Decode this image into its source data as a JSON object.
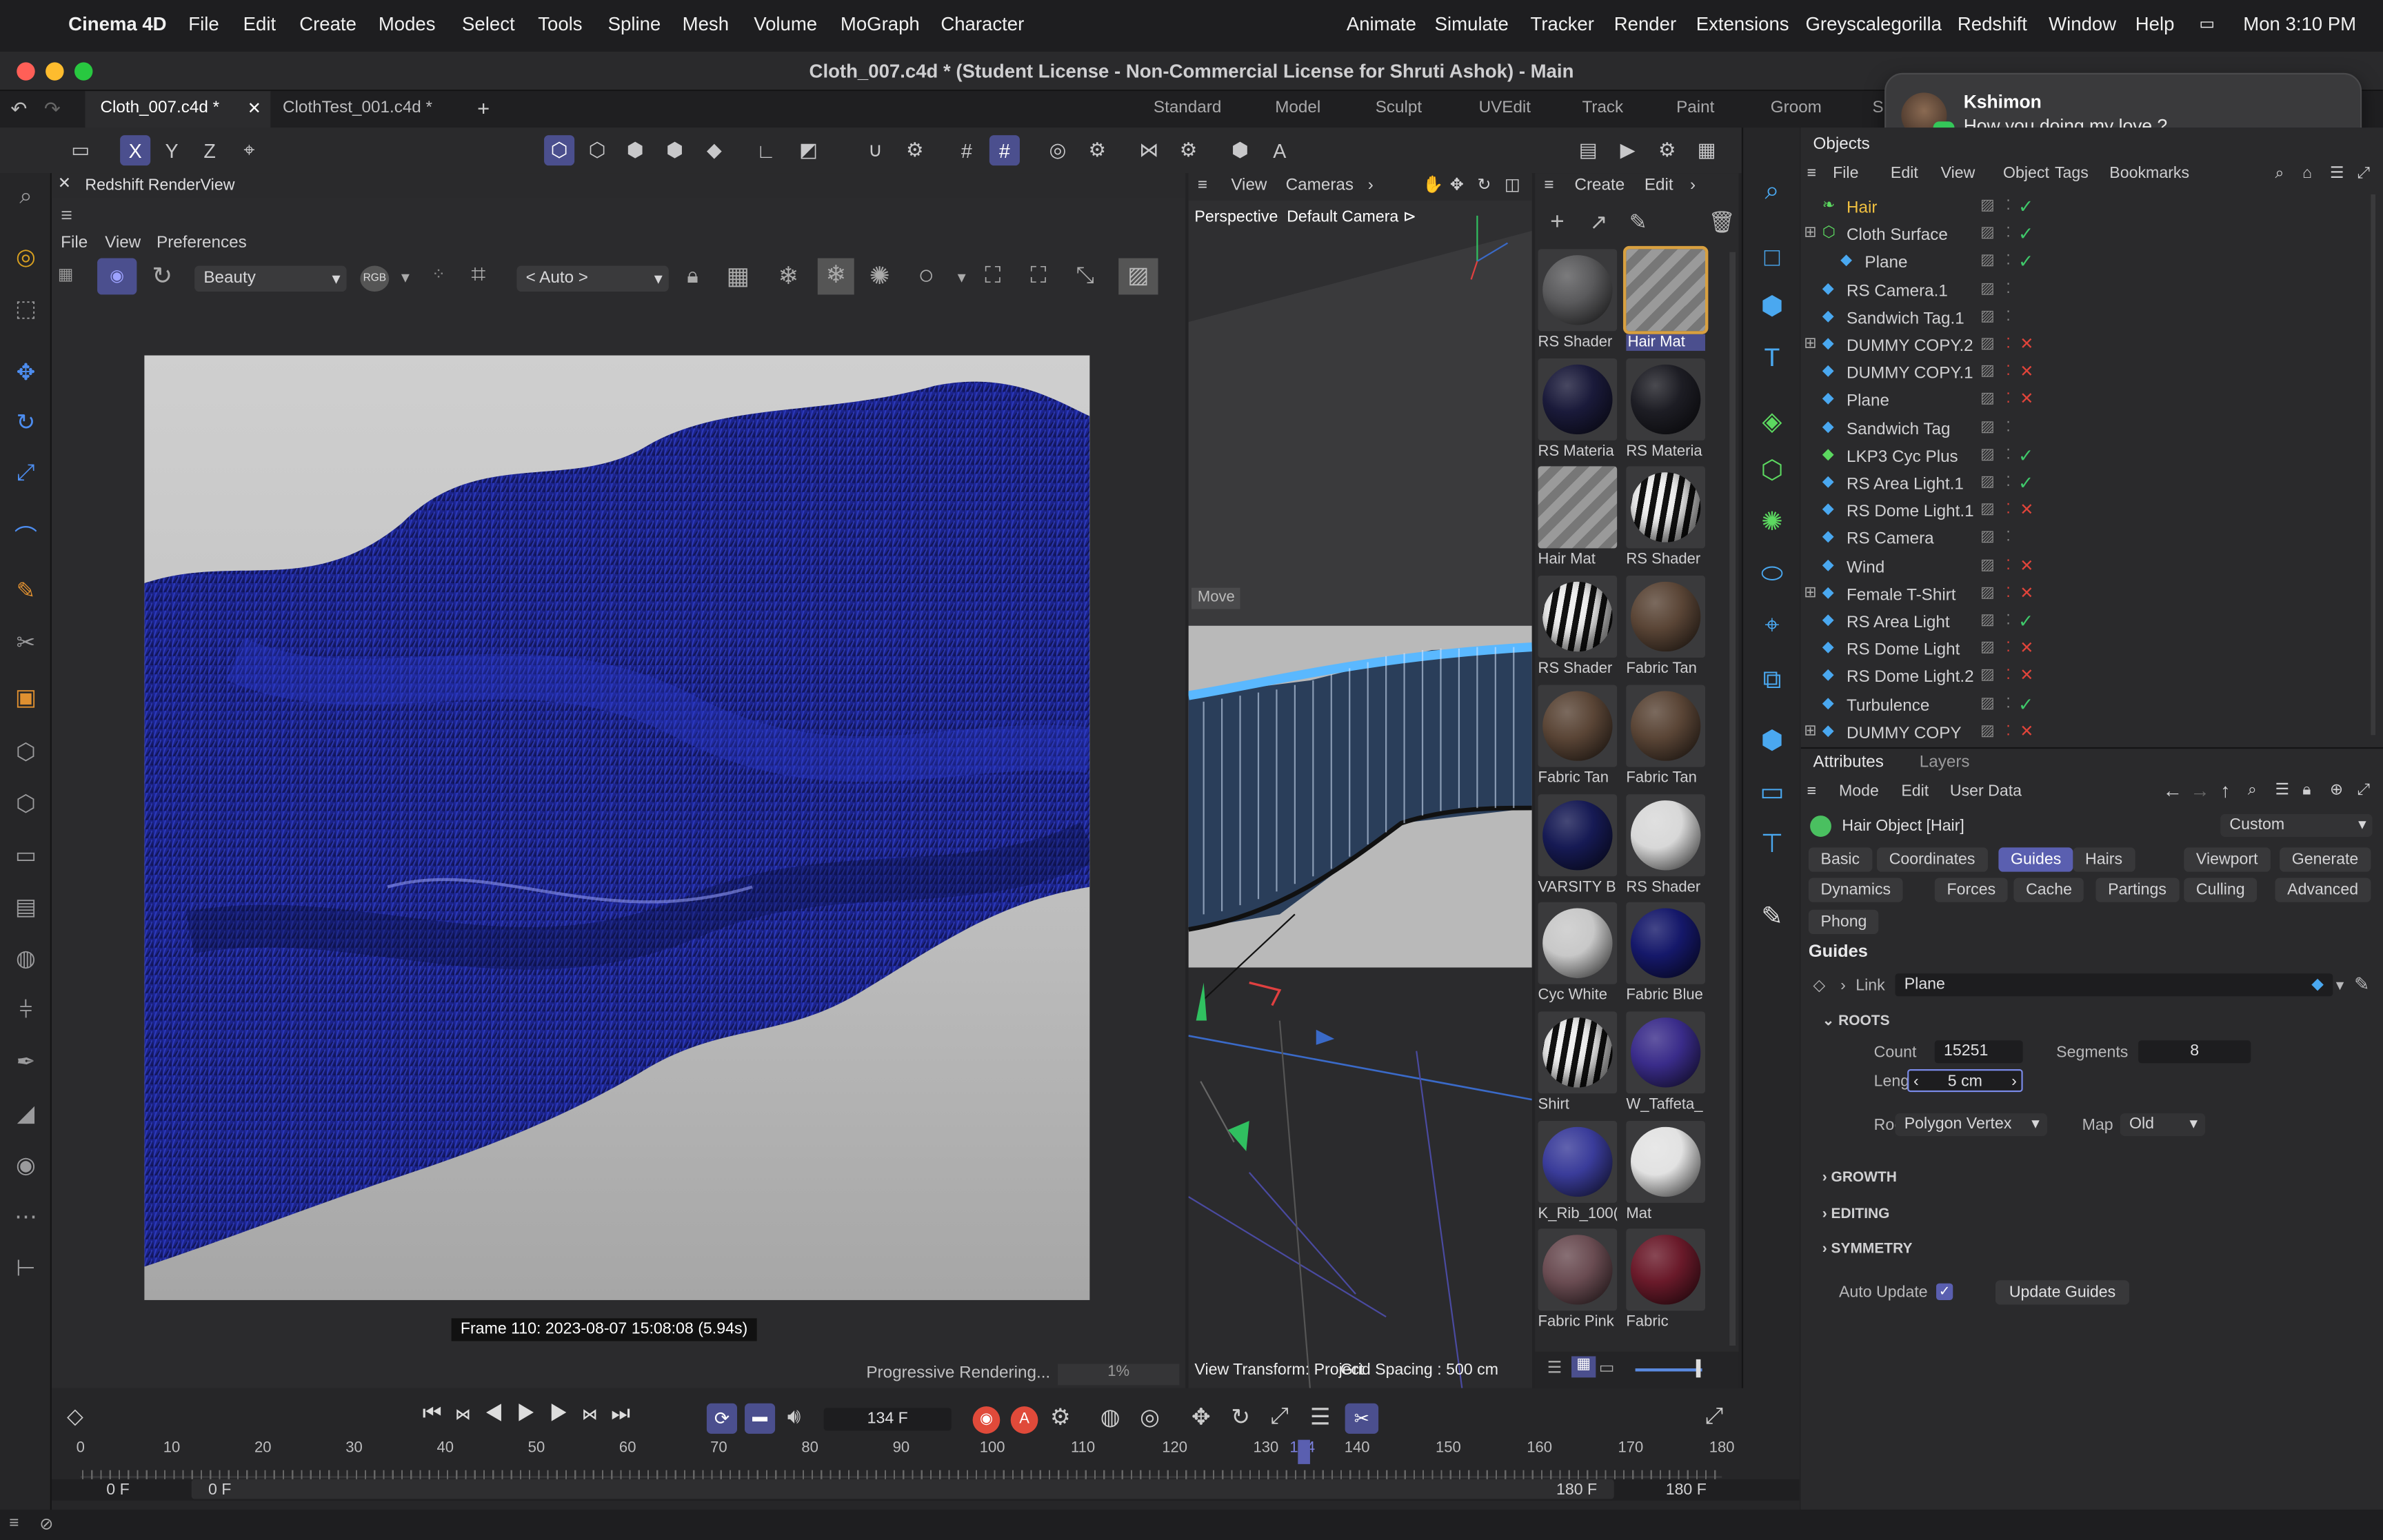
{
  "menubar": {
    "app": "Cinema 4D",
    "items": [
      "File",
      "Edit",
      "Create",
      "Modes",
      "Select",
      "Tools",
      "Spline",
      "Mesh",
      "Volume",
      "MoGraph",
      "Character"
    ],
    "right_items": [
      "Animate",
      "Simulate",
      "Tracker",
      "Render",
      "Extensions",
      "Greyscalegorilla",
      "Redshift",
      "Window",
      "Help"
    ],
    "clock": "Mon  3:10 PM"
  },
  "window": {
    "title": "Cloth_007.c4d * (Student License - Non-Commercial License for Shruti Ashok) - Main"
  },
  "tabs": [
    "Cloth_007.c4d *",
    "ClothTest_001.c4d *"
  ],
  "layouts": [
    "Standard",
    "Model",
    "Sculpt",
    "UVEdit",
    "Track",
    "Paint",
    "Groom",
    "S"
  ],
  "notification": {
    "sender": "Kshimon",
    "message": "How you doing my love ?"
  },
  "renderview": {
    "title": "Redshift RenderView",
    "menu": [
      "File",
      "View",
      "Preferences"
    ],
    "aov": "Beauty",
    "rgb": "RGB",
    "camera": "< Auto >",
    "frame_info": "Frame  110:  2023-08-07  15:08:08  (5.94s)",
    "progress_text": "Progressive Rendering...",
    "progress_pct": "1%"
  },
  "viewport": {
    "menu": [
      "View",
      "Cameras"
    ],
    "label": "Perspective",
    "camera": "Default Camera",
    "move": "Move",
    "bottom": "View Transform: Project",
    "grid": "Grid Spacing : 500 cm"
  },
  "materials": {
    "menu": [
      "Create",
      "Edit"
    ],
    "items": [
      {
        "name": "RS Shader",
        "color": "#5a5a5c"
      },
      {
        "name": "Hair Mat",
        "color": "#8a8a8a",
        "striped": true,
        "selected": true
      },
      {
        "name": "RS Materia",
        "color": "#1a1a3a"
      },
      {
        "name": "RS Materia",
        "color": "#1d1d24"
      },
      {
        "name": "Hair Mat",
        "color": "#8a8a8a",
        "striped": true
      },
      {
        "name": "RS Shader",
        "color": "#e8e8e8",
        "zebra": true
      },
      {
        "name": "RS Shader",
        "color": "#e8e8e8",
        "zebra": true
      },
      {
        "name": "Fabric Tan",
        "color": "#5a4536"
      },
      {
        "name": "Fabric Tan",
        "color": "#5a4536"
      },
      {
        "name": "Fabric Tan",
        "color": "#5a4536"
      },
      {
        "name": "VARSITY B",
        "color": "#161a54"
      },
      {
        "name": "RS Shader",
        "color": "#d8d8d8"
      },
      {
        "name": "Cyc White",
        "color": "#c8c8c8"
      },
      {
        "name": "Fabric Blue",
        "color": "#15186a"
      },
      {
        "name": "Shirt",
        "color": "#e0e0e0",
        "zebra": true
      },
      {
        "name": "W_Taffeta_",
        "color": "#3a2c8a"
      },
      {
        "name": "K_Rib_100(",
        "color": "#3a3c9a"
      },
      {
        "name": "Mat",
        "color": "#e2e2e2"
      },
      {
        "name": "Fabric Pink",
        "color": "#6a4c52"
      },
      {
        "name": "Fabric",
        "color": "#6a1a2a"
      }
    ]
  },
  "objects": {
    "tabs": [
      "Objects"
    ],
    "menu": [
      "File",
      "Edit",
      "View",
      "Object",
      "Tags",
      "Bookmarks"
    ],
    "rows": [
      {
        "name": "Hair",
        "indent": 0,
        "state": "check",
        "sel": true
      },
      {
        "name": "Cloth Surface",
        "indent": 0,
        "state": "check",
        "expand": true
      },
      {
        "name": "Plane",
        "indent": 1,
        "state": "check"
      },
      {
        "name": "RS Camera.1",
        "indent": 0,
        "state": "none"
      },
      {
        "name": "Sandwich Tag.1",
        "indent": 0,
        "state": "none"
      },
      {
        "name": "DUMMY COPY.2",
        "indent": 0,
        "state": "x",
        "expand": true
      },
      {
        "name": "DUMMY COPY.1",
        "indent": 0,
        "state": "x"
      },
      {
        "name": "Plane",
        "indent": 0,
        "state": "x"
      },
      {
        "name": "Sandwich Tag",
        "indent": 0,
        "state": "none"
      },
      {
        "name": "LKP3 Cyc Plus",
        "indent": 0,
        "state": "check"
      },
      {
        "name": "RS Area Light.1",
        "indent": 0,
        "state": "check"
      },
      {
        "name": "RS Dome Light.1",
        "indent": 0,
        "state": "x"
      },
      {
        "name": "RS Camera",
        "indent": 0,
        "state": "none"
      },
      {
        "name": "Wind",
        "indent": 0,
        "state": "x"
      },
      {
        "name": "Female T-Shirt",
        "indent": 0,
        "state": "x",
        "expand": true
      },
      {
        "name": "RS Area Light",
        "indent": 0,
        "state": "check"
      },
      {
        "name": "RS Dome Light",
        "indent": 0,
        "state": "x"
      },
      {
        "name": "RS Dome Light.2",
        "indent": 0,
        "state": "x"
      },
      {
        "name": "Turbulence",
        "indent": 0,
        "state": "check"
      },
      {
        "name": "DUMMY COPY",
        "indent": 0,
        "state": "x",
        "expand": true
      }
    ]
  },
  "attributes": {
    "tabs": [
      "Attributes",
      "Layers"
    ],
    "menu": [
      "Mode",
      "Edit",
      "User Data"
    ],
    "object": "Hair Object [Hair]",
    "preset": "Custom",
    "pages": [
      "Basic",
      "Coordinates",
      "Guides",
      "Hairs",
      "Viewport",
      "Generate",
      "Dynamics",
      "Forces",
      "Cache",
      "Partings",
      "Culling",
      "Advanced",
      "Phong"
    ],
    "active_page": "Guides",
    "section": "Guides",
    "link_label": "Link",
    "link_value": "Plane",
    "roots_label": "ROOTS",
    "count_label": "Count",
    "count": "15251",
    "segments_label": "Segments",
    "segments": "8",
    "length_label": "Length",
    "length": "5 cm",
    "root_label": "Root",
    "root_value": "Polygon Vertex",
    "map_label": "Map",
    "map_value": "Old",
    "groups": [
      "GROWTH",
      "EDITING",
      "SYMMETRY"
    ],
    "auto_update": "Auto Update",
    "update_button": "Update Guides"
  },
  "timeline": {
    "frame": "134 F",
    "ticks": [
      "0",
      "10",
      "20",
      "30",
      "40",
      "50",
      "60",
      "70",
      "80",
      "90",
      "100",
      "110",
      "120",
      "130",
      "134",
      "140",
      "150",
      "160",
      "170",
      "180"
    ],
    "start": "0 F",
    "start2": "0 F",
    "end": "180 F",
    "end2": "180 F"
  },
  "colors": {
    "accent": "#5a5fb0",
    "blue_obj": "#4aa8f0",
    "check": "#3fc86a",
    "cross": "#e0443a"
  }
}
